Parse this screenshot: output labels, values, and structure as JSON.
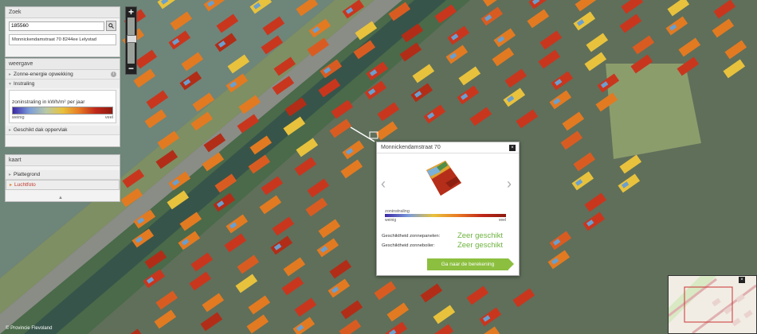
{
  "search": {
    "title": "Zoek",
    "value": "185560",
    "result": "Monnickendamstraat 70 8244ee Lelystad"
  },
  "display": {
    "title": "weergave",
    "items": [
      {
        "label": "Zonne-energie opwekking"
      },
      {
        "label": "Instraling"
      },
      {
        "label": "Geschikt dak oppervlak"
      }
    ],
    "legend_title": "zoninstraling in kWh/m² per jaar",
    "legend_low": "weinig",
    "legend_high": "veel"
  },
  "map_panel": {
    "title": "kaart",
    "items": [
      {
        "label": "Plattegrond"
      },
      {
        "label": "Luchtfoto"
      }
    ]
  },
  "zoom": {
    "plus": "+",
    "minus": "−"
  },
  "popup": {
    "title": "Monnickendamstraat 70",
    "close": "×",
    "prev": "‹",
    "next": "›",
    "legend_label": "zoninstraling",
    "legend_low": "weinig",
    "legend_high": "veel",
    "rows": [
      {
        "label": "Geschiktheid zonnepanelen:",
        "value": "Zeer geschikt"
      },
      {
        "label": "Geschiktheid zonneboiler:",
        "value": "Zeer geschikt"
      }
    ],
    "button": "Ga naar de berekening"
  },
  "overview_close": "×",
  "credit": "© Provincie Flevoland",
  "colors": {
    "accent_green": "#8cbf3f",
    "suitability_green": "#6db33f",
    "roof_red": "#c9361e",
    "roof_orange": "#e27a22",
    "roof_yellow": "#e8c23d",
    "water": "#6e857a"
  }
}
